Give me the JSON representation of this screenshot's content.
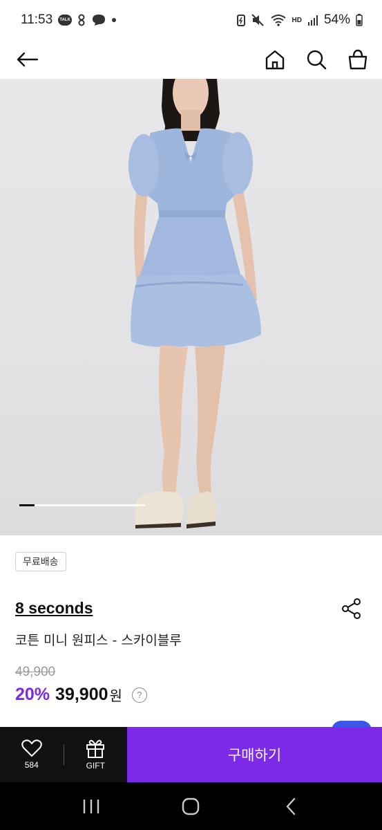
{
  "status_bar": {
    "time": "11:53",
    "talk_badge": "TALK",
    "hd_label": "HD",
    "battery": "54%"
  },
  "top_nav": {
    "icons": [
      "back-arrow-icon",
      "home-icon",
      "search-icon",
      "shopping-bag-icon"
    ]
  },
  "gallery": {
    "current_index": 1,
    "progress_fraction": 0.12
  },
  "product": {
    "shipping_badge": "무료배송",
    "brand": "8 seconds",
    "name": "코튼 미니 원피스 - 스카이블루",
    "original_price": "49,900",
    "discount": "20%",
    "sale_price": "39,900",
    "currency": "원",
    "help": "?"
  },
  "bottom_bar": {
    "like_count": "584",
    "gift_label": "GIFT",
    "buy_label": "구매하기"
  },
  "colors": {
    "accent": "#7c2ae8",
    "dark_bar": "#111111",
    "fab": "#3a57e8"
  }
}
